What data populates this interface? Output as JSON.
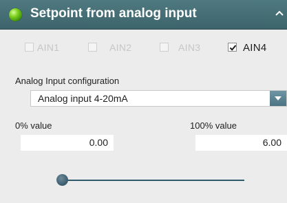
{
  "header": {
    "title": "Setpoint from analog input"
  },
  "inputs": [
    {
      "label": "AIN1",
      "checked": false
    },
    {
      "label": "AIN2",
      "checked": false
    },
    {
      "label": "AIN3",
      "checked": false
    },
    {
      "label": "AIN4",
      "checked": true
    }
  ],
  "config": {
    "label": "Analog Input configuration",
    "selected": "Analog input 4-20mA"
  },
  "range": {
    "min_label": "0% value",
    "min_value": "0.00",
    "max_label": "100% value",
    "max_value": "6.00"
  },
  "slider": {
    "level": 0.0
  },
  "colors": {
    "header": "#456d74",
    "accent": "#4c7483",
    "status": "#6fc21a"
  }
}
